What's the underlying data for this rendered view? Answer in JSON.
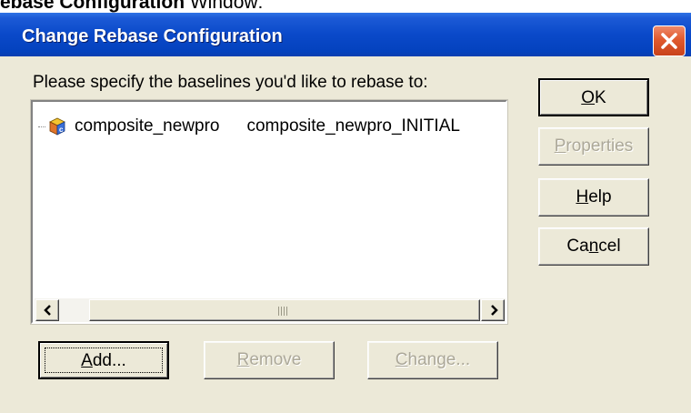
{
  "page_caption": {
    "bold": "ebase Configuration",
    "rest": " Window:"
  },
  "window": {
    "title": "Change Rebase Configuration",
    "close_icon": "close-icon",
    "prompt": "Please specify the baselines you'd like to rebase to:"
  },
  "list": {
    "rows": [
      {
        "icon": "component-icon",
        "name": "composite_newpro",
        "baseline": "composite_newpro_INITIAL"
      }
    ],
    "scrollbar": {
      "left_icon": "arrow-left-icon",
      "right_icon": "arrow-right-icon"
    }
  },
  "buttons": {
    "ok": {
      "pre": "",
      "accel": "O",
      "post": "K",
      "enabled": true
    },
    "properties": {
      "pre": "",
      "accel": "P",
      "post": "roperties",
      "enabled": false
    },
    "help": {
      "pre": "",
      "accel": "H",
      "post": "elp",
      "enabled": true
    },
    "cancel": {
      "pre": "Ca",
      "accel": "n",
      "post": "cel",
      "enabled": true
    },
    "add": {
      "pre": "",
      "accel": "A",
      "post": "dd...",
      "enabled": true
    },
    "remove": {
      "pre": "",
      "accel": "R",
      "post": "emove",
      "enabled": false
    },
    "change": {
      "pre": "",
      "accel": "C",
      "post": "hange...",
      "enabled": false
    }
  },
  "colors": {
    "titlebar": "#0a49c9",
    "dialog_bg": "#ece9d8",
    "close_button": "#e05a2e",
    "disabled_text": "#aca899"
  }
}
